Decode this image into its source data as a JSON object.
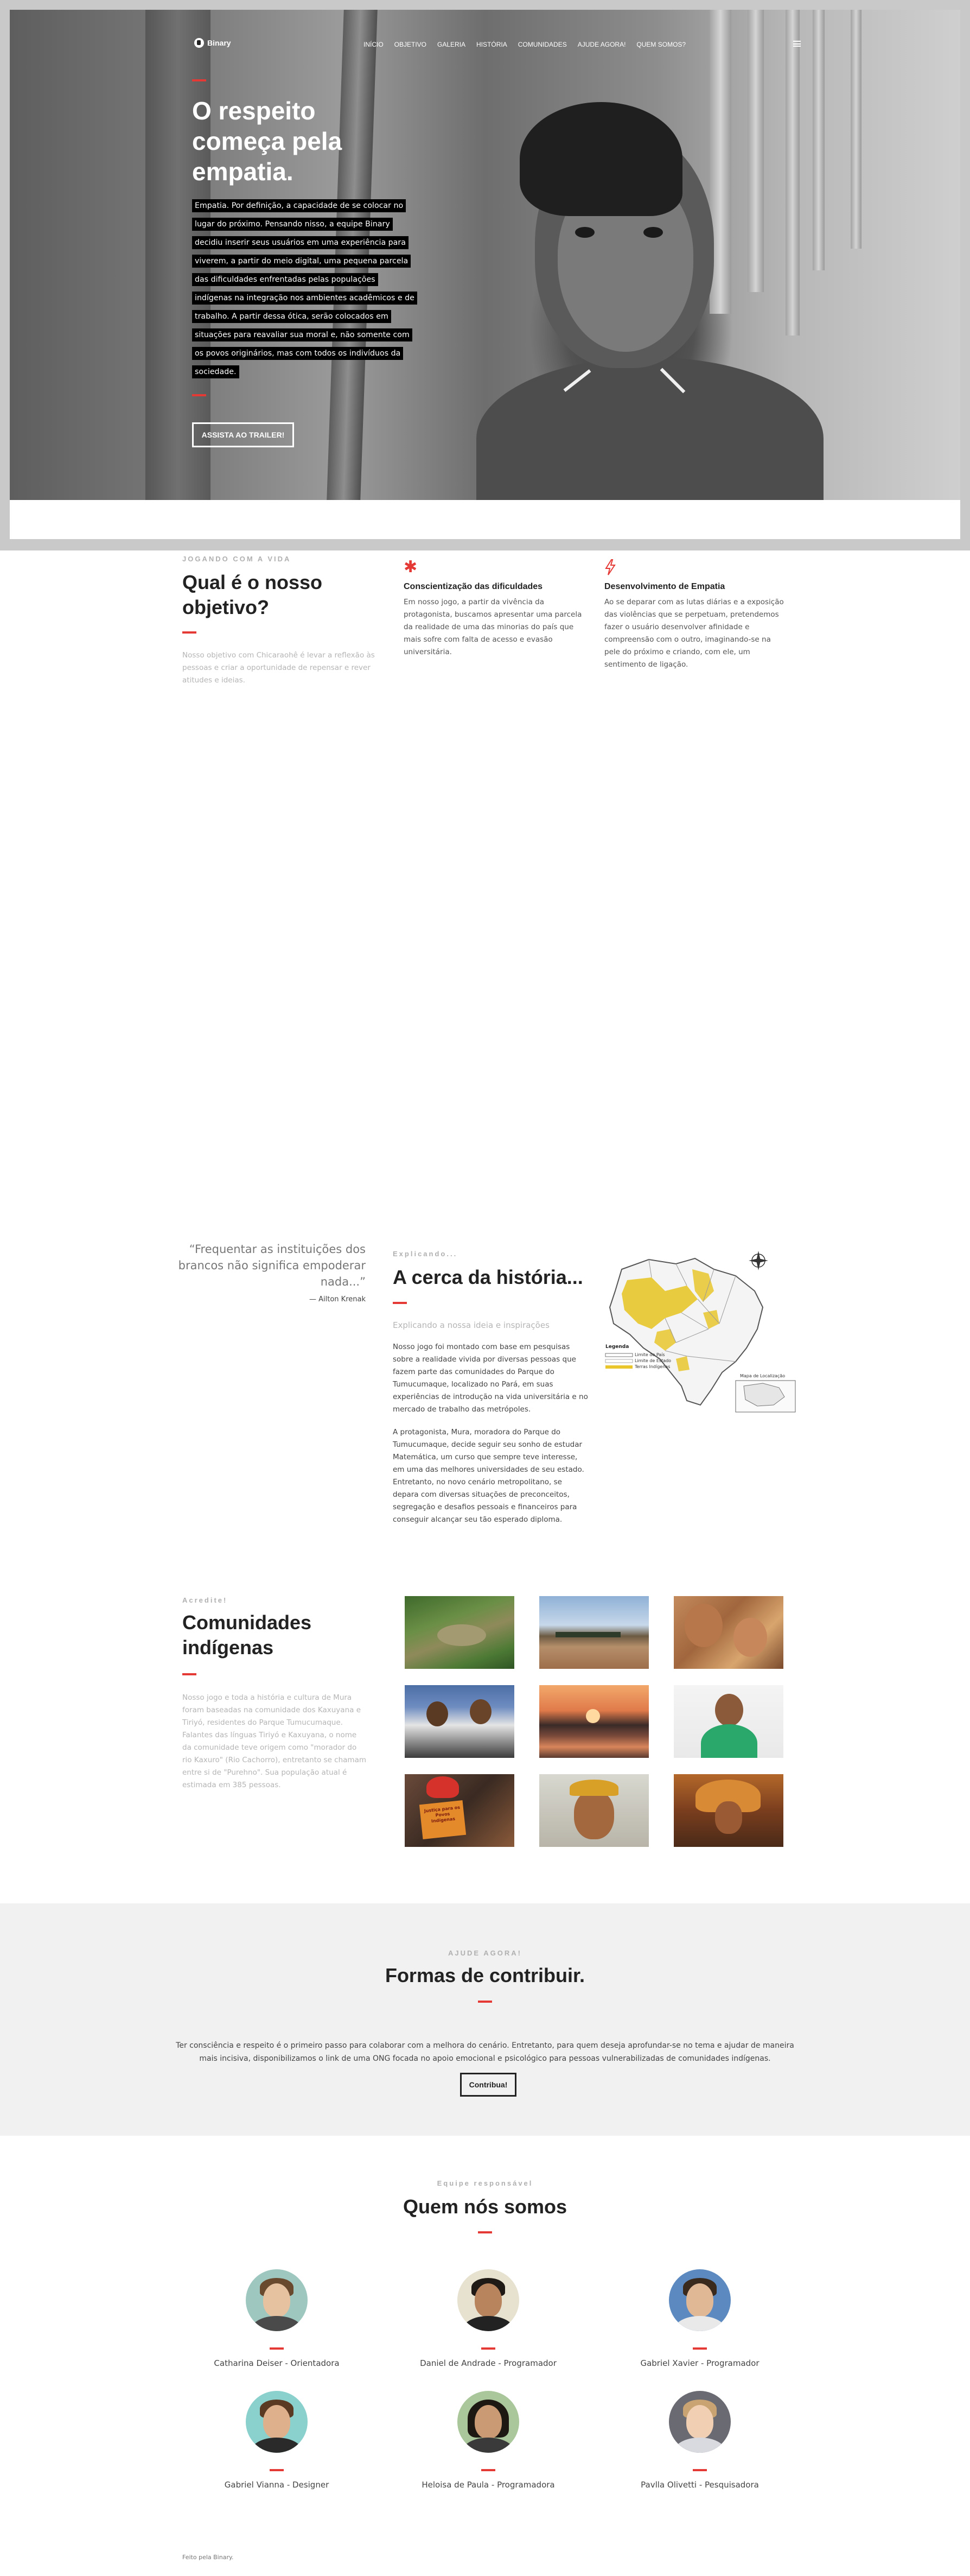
{
  "nav": {
    "brand": "Binary",
    "items": [
      "INÍCIO",
      "OBJETIVO",
      "GALERIA",
      "HISTÓRIA",
      "COMUNIDADES",
      "AJUDE AGORA!",
      "QUEM SOMOS?"
    ]
  },
  "hero": {
    "title": "O respeito começa pela empatia.",
    "text": "Empatia. Por definição, a capacidade de se colocar no lugar do próximo. Pensando nisso, a equipe Binary decidiu inserir seus usuários em uma experiência para viverem, a partir do meio digital, uma pequena parcela das dificuldades enfrentadas pelas populações indígenas na integração nos ambientes acadêmicos e de trabalho. A partir dessa ótica, serão colocados em situações para reavaliar sua moral e, não somente com os povos originários, mas com todos os indivíduos da sociedade.",
    "button": "ASSISTA AO TRAILER!"
  },
  "objective": {
    "kicker": "JOGANDO COM A VIDA",
    "title": "Qual é o nosso objetivo?",
    "text": "Nosso objetivo com Chicaraohê é levar a reflexão às pessoas e criar a oportunidade de repensar e rever atitudes e ideias.",
    "features": [
      {
        "icon": "asterisk-icon",
        "title": "Conscientização das dificuldades",
        "text": "Em nosso jogo, a partir da vivência da protagonista, buscamos apresentar uma parcela da realidade de uma das minorias do país que mais sofre com falta de acesso e evasão universitária."
      },
      {
        "icon": "lightning-icon",
        "title": "Desenvolvimento de Empatia",
        "text": "Ao se deparar com as lutas diárias e a exposição das violências que se perpetuam, pretendemos fazer o usuário desenvolver afinidade e compreensão com o outro, imaginando-se na pele do próximo e criando, com ele, um sentimento de ligação."
      }
    ]
  },
  "history": {
    "quote": "“Frequentar as instituições dos brancos não significa empoderar nada...”",
    "quote_author": "— Ailton Krenak",
    "kicker": "Explicando...",
    "title": "A cerca da história...",
    "subtitle": "Explicando a nossa ideia e inspirações",
    "paragraph1": "Nosso jogo foi montado com base em pesquisas sobre a realidade vivida por diversas pessoas que fazem parte das comunidades do Parque do Tumucumaque, localizado no Pará, em suas experiências de introdução na vida universitária e no mercado de trabalho das metrópoles.",
    "paragraph2": "A protagonista, Mura, moradora do Parque do Tumucumaque, decide seguir seu sonho de estudar Matemática, um curso que sempre teve interesse, em uma das melhores universidades de seu estado. Entretanto, no novo cenário metropolitano, se depara com diversas situações de preconceitos, segregação e desafios pessoais e financeiros para conseguir alcançar seu tão esperado diploma.",
    "map_legend_title": "Legenda",
    "map_legend_items": [
      "Limite do País",
      "Limite de Estado",
      "Terras Indígenas"
    ],
    "map_inset_label": "Mapa de Localização"
  },
  "communities": {
    "kicker": "Acredite!",
    "title": "Comunidades indígenas",
    "text": "Nosso jogo e toda a história e cultura de Mura foram baseadas na comunidade dos Kaxuyana e Tiriyó, residentes do Parque Tumucumaque. Falantes das línguas Tiriyó e Kaxuyana, o nome da comunidade teve origem como \"morador do rio Kaxuro\" (Rio Cachorro), entretanto se chamam entre si de \"Purehno\". Sua população atual é estimada em 385 pessoas.",
    "photos": [
      {
        "name": "photo-aerial-village"
      },
      {
        "name": "photo-river-boats"
      },
      {
        "name": "photo-mother-child"
      },
      {
        "name": "photo-students-reading"
      },
      {
        "name": "photo-sunset-river"
      },
      {
        "name": "photo-woman-speaker"
      },
      {
        "name": "photo-protest-sign",
        "sign_text": "Justiça para os Povos Indígenas"
      },
      {
        "name": "photo-painted-face"
      },
      {
        "name": "photo-feather-headdress"
      }
    ]
  },
  "contribute": {
    "kicker": "AJUDE AGORA!",
    "title": "Formas de contribuir.",
    "text": "Ter consciência e respeito é o primeiro passo para colaborar com a melhora do cenário. Entretanto, para quem deseja aprofundar-se no tema e ajudar de maneira mais incisiva, disponibilizamos o link de uma ONG focada no apoio emocional e psicológico para pessoas vulnerabilizadas de comunidades indígenas.",
    "button": "Contribua!"
  },
  "team": {
    "kicker": "Equipe responsável",
    "title": "Quem nós somos",
    "members": [
      "Catharina Deiser - Orientadora",
      "Daniel de Andrade - Programador",
      "Gabriel Xavier - Programador",
      "Gabriel Vianna - Designer",
      "Heloisa de Paula - Programadora",
      "Pavlla Olivetti - Pesquisadora"
    ]
  },
  "footer": {
    "credit": "Feito pela Binary."
  },
  "colors": {
    "accent": "#e53935",
    "hero_text_bg": "#000000",
    "section_bg": "#f1f1f1"
  }
}
